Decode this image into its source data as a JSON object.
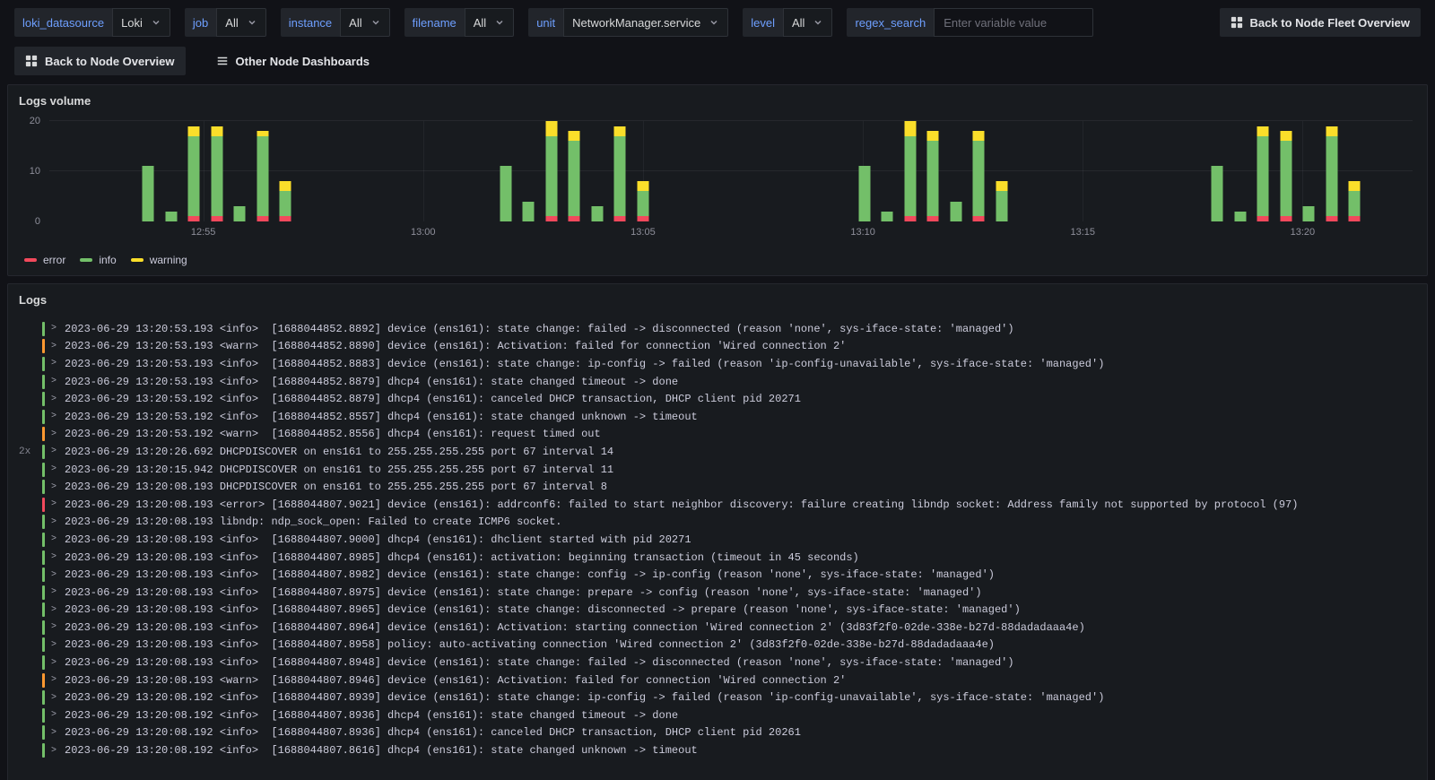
{
  "variables": [
    {
      "label": "loki_datasource",
      "value": "Loki"
    },
    {
      "label": "job",
      "value": "All"
    },
    {
      "label": "instance",
      "value": "All"
    },
    {
      "label": "filename",
      "value": "All"
    },
    {
      "label": "unit",
      "value": "NetworkManager.service"
    },
    {
      "label": "level",
      "value": "All"
    },
    {
      "label": "regex_search",
      "placeholder": "Enter variable value"
    }
  ],
  "nav": {
    "fleet_overview": {
      "label": "Back to Node Fleet Overview",
      "icon": "apps-grid-icon"
    },
    "node_overview": {
      "label": "Back to Node Overview",
      "icon": "apps-grid-icon"
    },
    "other_dashboards": {
      "label": "Other Node Dashboards",
      "icon": "menu-icon"
    }
  },
  "panels": {
    "volume_title": "Logs volume",
    "logs_title": "Logs"
  },
  "chart_data": {
    "type": "bar",
    "stacked": true,
    "title": "Logs volume",
    "ylim": [
      0,
      20
    ],
    "yticks": [
      0,
      10,
      20
    ],
    "x_range_minutes": 31,
    "xticks": [
      {
        "t": 3.5,
        "label": "12:55"
      },
      {
        "t": 8.5,
        "label": "13:00"
      },
      {
        "t": 13.5,
        "label": "13:05"
      },
      {
        "t": 18.5,
        "label": "13:10"
      },
      {
        "t": 23.5,
        "label": "13:15"
      },
      {
        "t": 28.5,
        "label": "13:20"
      }
    ],
    "series": [
      {
        "name": "error",
        "color": "#f2495c"
      },
      {
        "name": "info",
        "color": "#73bf69"
      },
      {
        "name": "warning",
        "color": "#fade2a"
      }
    ],
    "bars": [
      {
        "t": 2.25,
        "error": 0,
        "info": 11,
        "warning": 0
      },
      {
        "t": 2.77,
        "error": 0,
        "info": 2,
        "warning": 0
      },
      {
        "t": 3.29,
        "error": 1,
        "info": 16,
        "warning": 2
      },
      {
        "t": 3.81,
        "error": 1,
        "info": 16,
        "warning": 2
      },
      {
        "t": 4.33,
        "error": 0,
        "info": 3,
        "warning": 0
      },
      {
        "t": 4.85,
        "error": 1,
        "info": 16,
        "warning": 1
      },
      {
        "t": 5.37,
        "error": 1,
        "info": 5,
        "warning": 2
      },
      {
        "t": 10.38,
        "error": 0,
        "info": 11,
        "warning": 0
      },
      {
        "t": 10.9,
        "error": 0,
        "info": 4,
        "warning": 0
      },
      {
        "t": 11.42,
        "error": 1,
        "info": 16,
        "warning": 3
      },
      {
        "t": 11.94,
        "error": 1,
        "info": 15,
        "warning": 2
      },
      {
        "t": 12.46,
        "error": 0,
        "info": 3,
        "warning": 0
      },
      {
        "t": 12.98,
        "error": 1,
        "info": 16,
        "warning": 2
      },
      {
        "t": 13.5,
        "error": 1,
        "info": 5,
        "warning": 2
      },
      {
        "t": 18.53,
        "error": 0,
        "info": 11,
        "warning": 0
      },
      {
        "t": 19.05,
        "error": 0,
        "info": 2,
        "warning": 0
      },
      {
        "t": 19.57,
        "error": 1,
        "info": 16,
        "warning": 3
      },
      {
        "t": 20.09,
        "error": 1,
        "info": 15,
        "warning": 2
      },
      {
        "t": 20.61,
        "error": 0,
        "info": 4,
        "warning": 0
      },
      {
        "t": 21.13,
        "error": 1,
        "info": 15,
        "warning": 2
      },
      {
        "t": 21.65,
        "error": 0,
        "info": 6,
        "warning": 2
      },
      {
        "t": 26.56,
        "error": 0,
        "info": 11,
        "warning": 0
      },
      {
        "t": 27.08,
        "error": 0,
        "info": 2,
        "warning": 0
      },
      {
        "t": 27.6,
        "error": 1,
        "info": 16,
        "warning": 2
      },
      {
        "t": 28.12,
        "error": 1,
        "info": 15,
        "warning": 2
      },
      {
        "t": 28.64,
        "error": 0,
        "info": 3,
        "warning": 0
      },
      {
        "t": 29.16,
        "error": 1,
        "info": 16,
        "warning": 2
      },
      {
        "t": 29.68,
        "error": 1,
        "info": 5,
        "warning": 2
      }
    ]
  },
  "log_level_colors": {
    "info": "#73bf69",
    "warn": "#ff9830",
    "error": "#f2495c"
  },
  "logs": [
    {
      "level": "info",
      "dup": "",
      "text": "2023-06-29 13:20:53.193 <info>  [1688044852.8892] device (ens161): state change: failed -> disconnected (reason 'none', sys-iface-state: 'managed')"
    },
    {
      "level": "warn",
      "dup": "",
      "text": "2023-06-29 13:20:53.193 <warn>  [1688044852.8890] device (ens161): Activation: failed for connection 'Wired connection 2'"
    },
    {
      "level": "info",
      "dup": "",
      "text": "2023-06-29 13:20:53.193 <info>  [1688044852.8883] device (ens161): state change: ip-config -> failed (reason 'ip-config-unavailable', sys-iface-state: 'managed')"
    },
    {
      "level": "info",
      "dup": "",
      "text": "2023-06-29 13:20:53.193 <info>  [1688044852.8879] dhcp4 (ens161): state changed timeout -> done"
    },
    {
      "level": "info",
      "dup": "",
      "text": "2023-06-29 13:20:53.192 <info>  [1688044852.8879] dhcp4 (ens161): canceled DHCP transaction, DHCP client pid 20271"
    },
    {
      "level": "info",
      "dup": "",
      "text": "2023-06-29 13:20:53.192 <info>  [1688044852.8557] dhcp4 (ens161): state changed unknown -> timeout"
    },
    {
      "level": "warn",
      "dup": "",
      "text": "2023-06-29 13:20:53.192 <warn>  [1688044852.8556] dhcp4 (ens161): request timed out"
    },
    {
      "level": "info",
      "dup": "2x",
      "text": "2023-06-29 13:20:26.692 DHCPDISCOVER on ens161 to 255.255.255.255 port 67 interval 14"
    },
    {
      "level": "info",
      "dup": "",
      "text": "2023-06-29 13:20:15.942 DHCPDISCOVER on ens161 to 255.255.255.255 port 67 interval 11"
    },
    {
      "level": "info",
      "dup": "",
      "text": "2023-06-29 13:20:08.193 DHCPDISCOVER on ens161 to 255.255.255.255 port 67 interval 8"
    },
    {
      "level": "error",
      "dup": "",
      "text": "2023-06-29 13:20:08.193 <error> [1688044807.9021] device (ens161): addrconf6: failed to start neighbor discovery: failure creating libndp socket: Address family not supported by protocol (97)"
    },
    {
      "level": "info",
      "dup": "",
      "text": "2023-06-29 13:20:08.193 libndp: ndp_sock_open: Failed to create ICMP6 socket."
    },
    {
      "level": "info",
      "dup": "",
      "text": "2023-06-29 13:20:08.193 <info>  [1688044807.9000] dhcp4 (ens161): dhclient started with pid 20271"
    },
    {
      "level": "info",
      "dup": "",
      "text": "2023-06-29 13:20:08.193 <info>  [1688044807.8985] dhcp4 (ens161): activation: beginning transaction (timeout in 45 seconds)"
    },
    {
      "level": "info",
      "dup": "",
      "text": "2023-06-29 13:20:08.193 <info>  [1688044807.8982] device (ens161): state change: config -> ip-config (reason 'none', sys-iface-state: 'managed')"
    },
    {
      "level": "info",
      "dup": "",
      "text": "2023-06-29 13:20:08.193 <info>  [1688044807.8975] device (ens161): state change: prepare -> config (reason 'none', sys-iface-state: 'managed')"
    },
    {
      "level": "info",
      "dup": "",
      "text": "2023-06-29 13:20:08.193 <info>  [1688044807.8965] device (ens161): state change: disconnected -> prepare (reason 'none', sys-iface-state: 'managed')"
    },
    {
      "level": "info",
      "dup": "",
      "text": "2023-06-29 13:20:08.193 <info>  [1688044807.8964] device (ens161): Activation: starting connection 'Wired connection 2' (3d83f2f0-02de-338e-b27d-88dadadaaa4e)"
    },
    {
      "level": "info",
      "dup": "",
      "text": "2023-06-29 13:20:08.193 <info>  [1688044807.8958] policy: auto-activating connection 'Wired connection 2' (3d83f2f0-02de-338e-b27d-88dadadaaa4e)"
    },
    {
      "level": "info",
      "dup": "",
      "text": "2023-06-29 13:20:08.193 <info>  [1688044807.8948] device (ens161): state change: failed -> disconnected (reason 'none', sys-iface-state: 'managed')"
    },
    {
      "level": "warn",
      "dup": "",
      "text": "2023-06-29 13:20:08.193 <warn>  [1688044807.8946] device (ens161): Activation: failed for connection 'Wired connection 2'"
    },
    {
      "level": "info",
      "dup": "",
      "text": "2023-06-29 13:20:08.192 <info>  [1688044807.8939] device (ens161): state change: ip-config -> failed (reason 'ip-config-unavailable', sys-iface-state: 'managed')"
    },
    {
      "level": "info",
      "dup": "",
      "text": "2023-06-29 13:20:08.192 <info>  [1688044807.8936] dhcp4 (ens161): state changed timeout -> done"
    },
    {
      "level": "info",
      "dup": "",
      "text": "2023-06-29 13:20:08.192 <info>  [1688044807.8936] dhcp4 (ens161): canceled DHCP transaction, DHCP client pid 20261"
    },
    {
      "level": "info",
      "dup": "",
      "text": "2023-06-29 13:20:08.192 <info>  [1688044807.8616] dhcp4 (ens161): state changed unknown -> timeout"
    }
  ]
}
